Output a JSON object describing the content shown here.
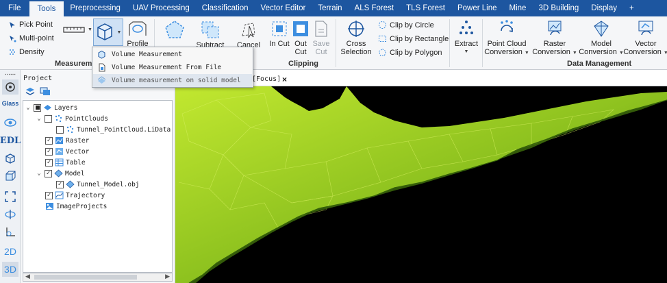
{
  "menu": [
    "File",
    "Tools",
    "Preprocessing",
    "UAV Processing",
    "Classification",
    "Vector Editor",
    "Terrain",
    "ALS Forest",
    "TLS Forest",
    "Power Line",
    "Mine",
    "3D Building",
    "Display",
    "+"
  ],
  "active_menu": "Tools",
  "ribbon": {
    "pick_point": "Pick Point",
    "multi_point": "Multi-point",
    "density": "Density",
    "measurement_group": "Measurement",
    "profile": "Profile",
    "subtract": "Subtract",
    "cancel": "Cancel",
    "selection_frag": "ion",
    "in_cut": "In Cut",
    "out_cut_1": "Out",
    "out_cut_2": "Cut",
    "save_cut_1": "Save",
    "save_cut_2": "Cut",
    "clipping_group": "Clipping",
    "cross_1": "Cross",
    "cross_2": "Selection",
    "clip_circle": "Clip by Circle",
    "clip_rectangle": "Clip by Rectangle",
    "clip_polygon": "Clip by Polygon",
    "extract": "Extract",
    "pc_conv_1": "Point Cloud",
    "pc_conv_2": "Conversion",
    "raster_conv_1": "Raster",
    "raster_conv_2": "Conversion",
    "model_conv_1": "Model",
    "model_conv_2": "Conversion",
    "vector_conv_1": "Vector",
    "vector_conv_2": "Conversion",
    "data_mgmt_group": "Data Management"
  },
  "dropdown": [
    "Volume Measurement",
    "Volume Measurement From File",
    "Volume measurement on solid model"
  ],
  "left_strip": {
    "glass": "Glass",
    "edl": "EDL",
    "two_d": "2D",
    "three_d": "3D"
  },
  "project": {
    "title": "Project",
    "tree": [
      "Layers",
      "PointClouds",
      "Tunnel_PointCloud.LiData",
      "Raster",
      "Vector",
      "Table",
      "Model",
      "Tunnel_Model.obj",
      "Trajectory",
      "ImageProjects"
    ]
  },
  "view_tab": {
    "label": "[Focus]",
    "close": "×"
  },
  "colors": {
    "menubar": "#1d56a0",
    "mesh_light": "#b9e02a",
    "mesh_dark": "#4f7d10",
    "background": "#000000"
  }
}
